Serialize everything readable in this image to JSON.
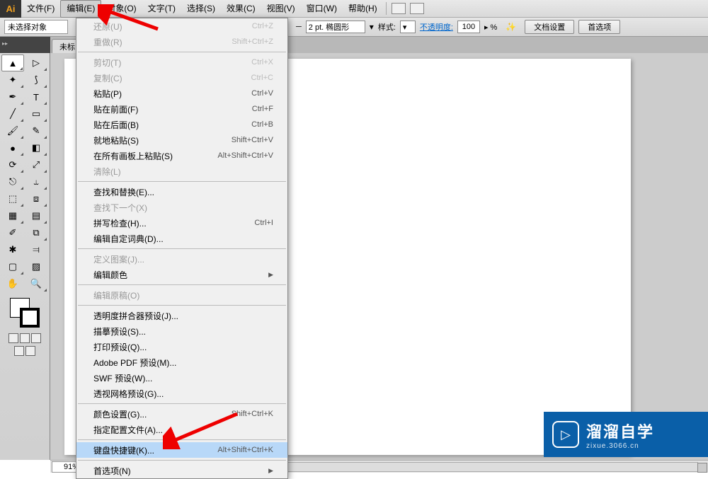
{
  "menubar": {
    "items": [
      "文件(F)",
      "编辑(E)",
      "对象(O)",
      "文字(T)",
      "选择(S)",
      "效果(C)",
      "视图(V)",
      "窗口(W)",
      "帮助(H)"
    ],
    "active_index": 1
  },
  "optionsbar": {
    "selection": "未选择对象",
    "stroke_value": "2 pt. 椭圆形",
    "style_label": "样式:",
    "opacity_label": "不透明度:",
    "opacity_value": "100",
    "opacity_link": "不透明度:",
    "doc_setup": "文档设置",
    "prefs": "首选项"
  },
  "tab": {
    "label": "未标",
    "close": "×"
  },
  "dropdown": {
    "groups": [
      [
        {
          "label": "还原(U)",
          "shortcut": "Ctrl+Z",
          "disabled": true
        },
        {
          "label": "重做(R)",
          "shortcut": "Shift+Ctrl+Z",
          "disabled": true
        }
      ],
      [
        {
          "label": "剪切(T)",
          "shortcut": "Ctrl+X",
          "disabled": true
        },
        {
          "label": "复制(C)",
          "shortcut": "Ctrl+C",
          "disabled": true
        },
        {
          "label": "粘贴(P)",
          "shortcut": "Ctrl+V"
        },
        {
          "label": "贴在前面(F)",
          "shortcut": "Ctrl+F"
        },
        {
          "label": "贴在后面(B)",
          "shortcut": "Ctrl+B"
        },
        {
          "label": "就地粘贴(S)",
          "shortcut": "Shift+Ctrl+V"
        },
        {
          "label": "在所有画板上粘贴(S)",
          "shortcut": "Alt+Shift+Ctrl+V"
        },
        {
          "label": "清除(L)",
          "shortcut": "",
          "disabled": true
        }
      ],
      [
        {
          "label": "查找和替换(E)...",
          "shortcut": ""
        },
        {
          "label": "查找下一个(X)",
          "shortcut": "",
          "disabled": true
        },
        {
          "label": "拼写检查(H)...",
          "shortcut": "Ctrl+I"
        },
        {
          "label": "编辑自定词典(D)...",
          "shortcut": ""
        }
      ],
      [
        {
          "label": "定义图案(J)...",
          "shortcut": "",
          "disabled": true
        },
        {
          "label": "编辑颜色",
          "shortcut": "",
          "submenu": true
        }
      ],
      [
        {
          "label": "编辑原稿(O)",
          "shortcut": "",
          "disabled": true
        }
      ],
      [
        {
          "label": "透明度拼合器预设(J)...",
          "shortcut": ""
        },
        {
          "label": "描摹预设(S)...",
          "shortcut": ""
        },
        {
          "label": "打印预设(Q)...",
          "shortcut": ""
        },
        {
          "label": "Adobe PDF 预设(M)...",
          "shortcut": ""
        },
        {
          "label": "SWF 预设(W)...",
          "shortcut": ""
        },
        {
          "label": "透视网格预设(G)...",
          "shortcut": ""
        }
      ],
      [
        {
          "label": "颜色设置(G)...",
          "shortcut": "Shift+Ctrl+K"
        },
        {
          "label": "指定配置文件(A)...",
          "shortcut": ""
        }
      ],
      [
        {
          "label": "键盘快捷键(K)...",
          "shortcut": "Alt+Shift+Ctrl+K",
          "highlight": true
        }
      ],
      [
        {
          "label": "首选项(N)",
          "shortcut": "",
          "submenu": true
        }
      ]
    ]
  },
  "status": {
    "zoom": "91%"
  },
  "watermark": {
    "main": "溜溜自学",
    "sub": "zixue.3066.cn",
    "icon": "▷"
  },
  "tools": [
    "sel",
    "direct",
    "wand",
    "lasso",
    "pen",
    "type",
    "line",
    "rect",
    "brush",
    "pencil",
    "blob",
    "eraser",
    "rotate",
    "scale",
    "width",
    "warp",
    "shape",
    "perspective",
    "mesh",
    "gradient",
    "eyedrop",
    "blend",
    "symbol",
    "graph",
    "artboard",
    "slice",
    "hand",
    "zoom"
  ],
  "tool_glyphs": [
    "▲",
    "▷",
    "✦",
    "⟆",
    "✒",
    "T",
    "╱",
    "▭",
    "🖌",
    "✎",
    "●",
    "◧",
    "⟳",
    "⤢",
    "⎋",
    "⥿",
    "⬚",
    "⧈",
    "▦",
    "▤",
    "✐",
    "⧉",
    "✱",
    "⫤",
    "▢",
    "▨",
    "✋",
    "🔍"
  ]
}
